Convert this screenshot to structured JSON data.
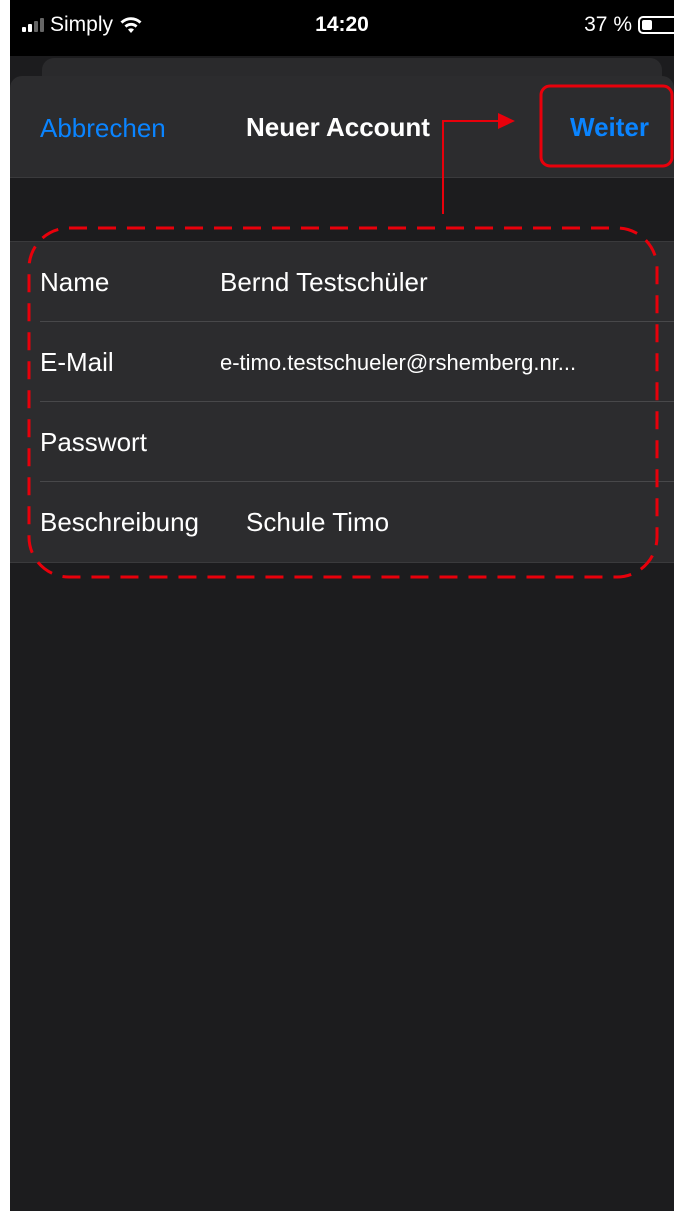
{
  "status_bar": {
    "carrier": "Simply",
    "time": "14:20",
    "battery_percent": "37 %",
    "signal_bars_active": 2,
    "signal_bars_total": 4,
    "battery_level": 0.37
  },
  "nav": {
    "cancel_label": "Abbrechen",
    "title": "Neuer Account",
    "next_label": "Weiter"
  },
  "form": {
    "rows": [
      {
        "label": "Name",
        "value": "Bernd Testschüler"
      },
      {
        "label": "E-Mail",
        "value": "e-timo.testschueler@rshemberg.nr..."
      },
      {
        "label": "Passwort",
        "value": ""
      },
      {
        "label": "Beschreibung",
        "value": "Schule Timo"
      }
    ]
  },
  "colors": {
    "accent": "#0a84ff",
    "annotation": "#e8000b",
    "background": "#1c1c1e",
    "cell": "#2c2c2e"
  }
}
